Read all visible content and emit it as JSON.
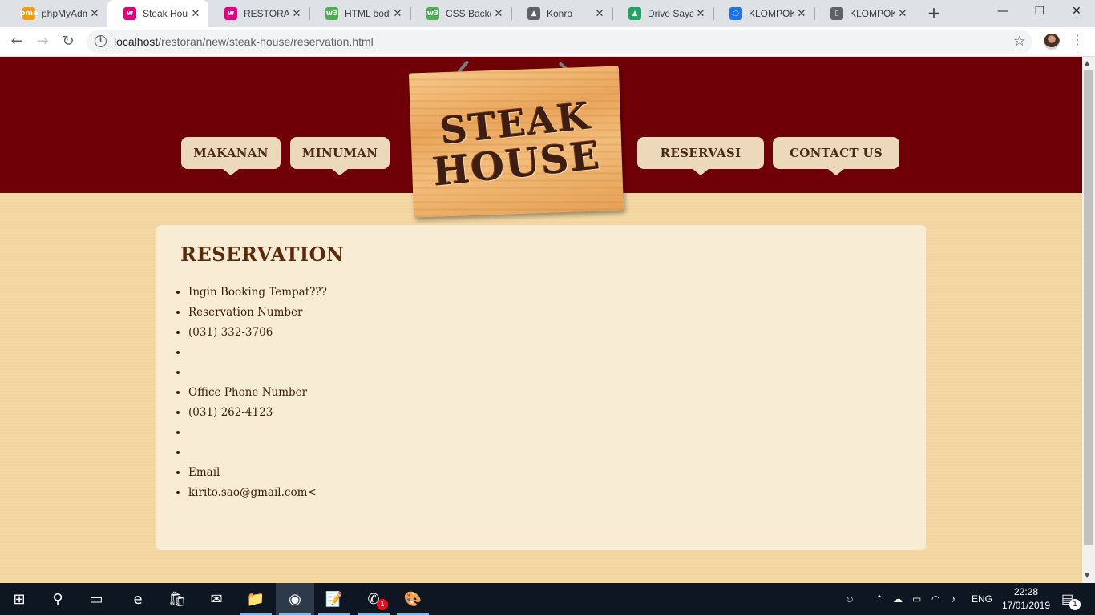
{
  "browser": {
    "tabs": [
      {
        "title": "phpMyAdmin",
        "icon": "phpmyadmin-icon",
        "color": "#f89c0e",
        "glyph": "pma",
        "active": false
      },
      {
        "title": "Steak House",
        "icon": "wamp-icon",
        "color": "#e6007e",
        "glyph": "w",
        "active": true
      },
      {
        "title": "RESTORAN",
        "icon": "wamp-icon",
        "color": "#e6007e",
        "glyph": "w",
        "active": false
      },
      {
        "title": "HTML body",
        "icon": "w3schools-icon",
        "color": "#4caf50",
        "glyph": "w3",
        "active": false
      },
      {
        "title": "CSS Backgr",
        "icon": "w3schools-icon",
        "color": "#4caf50",
        "glyph": "w3",
        "active": false
      },
      {
        "title": "Konro",
        "icon": "konro-icon",
        "color": "#5f6368",
        "glyph": "▲",
        "active": false
      },
      {
        "title": "Drive Saya",
        "icon": "google-drive-icon",
        "color": "#1fa463",
        "glyph": "▲",
        "active": false
      },
      {
        "title": "KLOMPOK",
        "icon": "loading-icon",
        "color": "#1a73e8",
        "glyph": "◌",
        "active": false
      },
      {
        "title": "KLOMPOK",
        "icon": "document-icon",
        "color": "#5f6368",
        "glyph": "▯",
        "active": false
      }
    ],
    "close_glyph": "✕",
    "new_tab_glyph": "+",
    "window": {
      "minimize": "—",
      "restore": "❐",
      "close": "✕"
    },
    "url_host": "localhost",
    "url_path": "/restoran/new/steak-house/reservation.html",
    "info_glyph": "i",
    "star_glyph": "☆",
    "back_glyph": "←",
    "forward_glyph": "→",
    "reload_glyph": "↻",
    "menu_glyph": "⋮"
  },
  "site": {
    "nav": {
      "makanan": "MAKANAN",
      "minuman": "MINUMAN",
      "reservasi": "RESERVASI",
      "contact": "CONTACT US"
    },
    "logo": {
      "line1": "STEAK",
      "line2": "HOUSE"
    },
    "colors": {
      "header": "#700008",
      "panel": "#f8ecd5",
      "accent": "#5a2a0a"
    },
    "heading": "RESERVATION",
    "items": [
      "Ingin Booking Tempat???",
      "Reservation Number",
      "(031) 332-3706",
      "",
      "",
      "Office Phone Number",
      "(031) 262-4123",
      "",
      "",
      "Email",
      "kirito.sao@gmail.com<"
    ]
  },
  "taskbar": {
    "start_glyph": "⊞",
    "search_glyph": "⚲",
    "taskview_glyph": "▭",
    "apps": [
      {
        "name": "edge-icon",
        "glyph": "e"
      },
      {
        "name": "store-icon",
        "glyph": "🛍"
      },
      {
        "name": "mail-icon",
        "glyph": "✉"
      },
      {
        "name": "file-explorer-icon",
        "glyph": "📁"
      },
      {
        "name": "chrome-icon",
        "glyph": "◉"
      },
      {
        "name": "notepad-plus-icon",
        "glyph": "📝"
      },
      {
        "name": "whatsapp-icon",
        "glyph": "✆"
      },
      {
        "name": "paint-icon",
        "glyph": "🎨"
      }
    ],
    "whatsapp_badge": "1",
    "language": "ENG",
    "time": "22:28",
    "date": "17/01/2019",
    "notifications_count": "1"
  }
}
